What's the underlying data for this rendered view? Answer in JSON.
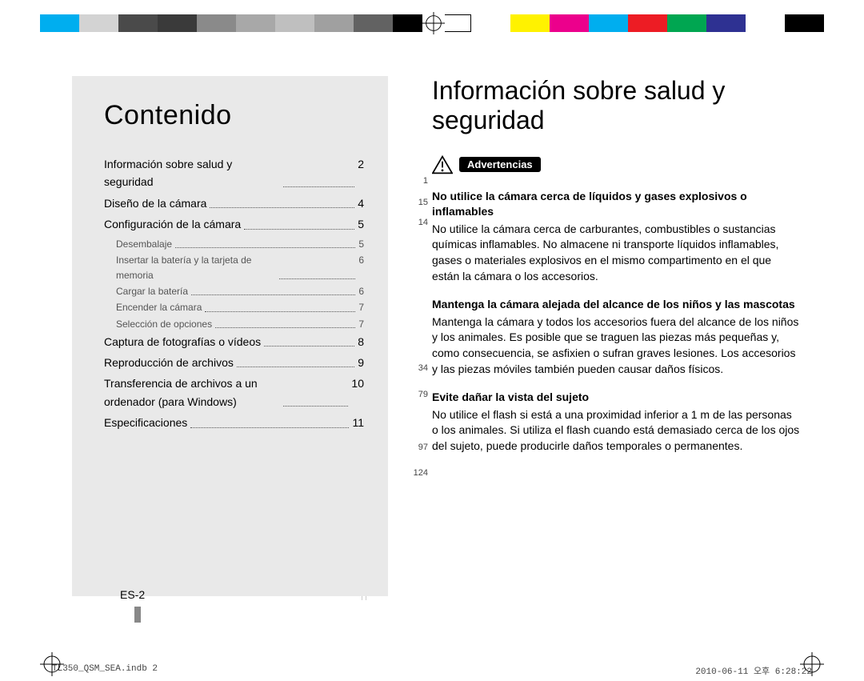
{
  "left": {
    "title": "Contenido",
    "toc": [
      {
        "label": "Información sobre salud y seguridad",
        "page": "2",
        "side": "1"
      },
      {
        "label": "Diseño de la cámara",
        "page": "4",
        "side": "15"
      },
      {
        "label": "Configuración de la cámara",
        "page": "5",
        "side": "14",
        "sub": [
          {
            "label": "Desembalaje",
            "page": "5"
          },
          {
            "label": "Insertar la batería y la tarjeta de memoria",
            "page": "6"
          },
          {
            "label": "Cargar la batería",
            "page": "6"
          },
          {
            "label": "Encender la cámara",
            "page": "7"
          },
          {
            "label": "Selección de opciones",
            "page": "7"
          }
        ]
      },
      {
        "label": "Captura de fotografías o vídeos",
        "page": "8",
        "side": "34"
      },
      {
        "label": "Reproducción de archivos",
        "page": "9",
        "side": "79"
      },
      {
        "label": "Transferencia de archivos a un ordenador (para Windows)",
        "page": "10",
        "side": "97"
      },
      {
        "label": "Especificaciones",
        "page": "11",
        "side": "124"
      }
    ]
  },
  "right": {
    "title": "Información sobre salud y seguridad",
    "adv_label": "Advertencias",
    "blocks": [
      {
        "h": "No utilice la cámara cerca de líquidos y gases explosivos o inflamables",
        "p": "No utilice la cámara cerca de carburantes, combustibles o sustancias químicas inflamables. No almacene ni transporte líquidos inflamables, gases o materiales explosivos en el mismo compartimento en el que están la cámara o los accesorios."
      },
      {
        "h": "Mantenga la cámara alejada del alcance de los niños y las mascotas",
        "p": "Mantenga la cámara y todos los accesorios fuera del alcance de los niños y los animales. Es posible que se traguen las piezas más pequeñas y, como consecuencia, se asfixien o sufran graves lesiones. Los accesorios y las piezas móviles también pueden causar daños físicos."
      },
      {
        "h": "Evite dañar la vista del sujeto",
        "p": "No utilice el flash si está a una proximidad inferior a 1 m de las personas o los animales. Si utiliza el flash cuando está demasiado cerca de los ojos del sujeto, puede producirle daños temporales o permanentes."
      }
    ]
  },
  "page_number": "ES-2",
  "footer_left": "TL350_QSM_SEA.indb   2",
  "footer_right": "2010-06-11   오후 6:28:22",
  "colorbar": [
    "#00aeef",
    "#d3d3d3",
    "#4a4a4a",
    "#3a3a3a",
    "#8a8a8a",
    "#a8a8a8",
    "#bfbfbf",
    "#a0a0a0",
    "#626262",
    "#000000",
    "#ffffff",
    "#ffffff",
    "#fff200",
    "#ec008c",
    "#00aeef",
    "#ed1c24",
    "#00a651",
    "#2e3192",
    "#ffffff",
    "#000000"
  ]
}
